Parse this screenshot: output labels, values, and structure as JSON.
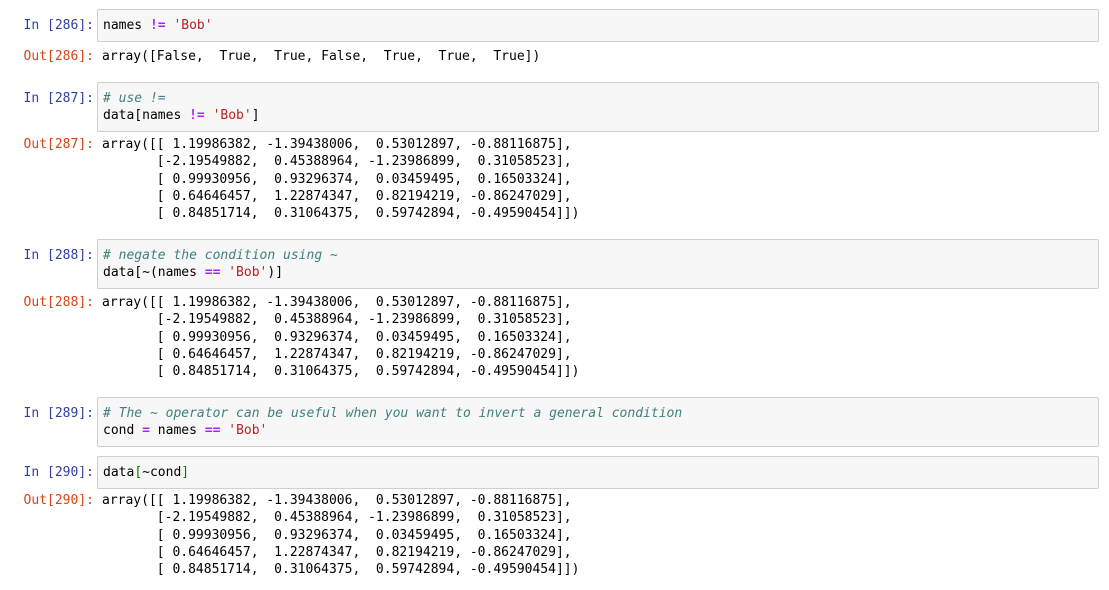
{
  "cells": [
    {
      "in_prompt": "In [286]:",
      "in_lines": [
        [
          {
            "t": "plain",
            "s": "names "
          },
          {
            "t": "op",
            "s": "!="
          },
          {
            "t": "plain",
            "s": " "
          },
          {
            "t": "str",
            "s": "'Bob'"
          }
        ]
      ],
      "out_prompt": "Out[286]:",
      "out_lines": [
        "array([False,  True,  True, False,  True,  True,  True])"
      ]
    },
    {
      "in_prompt": "In [287]:",
      "in_lines": [
        [
          {
            "t": "com",
            "s": "# use !="
          }
        ],
        [
          {
            "t": "plain",
            "s": "data[names "
          },
          {
            "t": "op",
            "s": "!="
          },
          {
            "t": "plain",
            "s": " "
          },
          {
            "t": "str",
            "s": "'Bob'"
          },
          {
            "t": "plain",
            "s": "]"
          }
        ]
      ],
      "out_prompt": "Out[287]:",
      "out_lines": [
        "array([[ 1.19986382, -1.39438006,  0.53012897, -0.88116875],",
        "       [-2.19549882,  0.45388964, -1.23986899,  0.31058523],",
        "       [ 0.99930956,  0.93296374,  0.03459495,  0.16503324],",
        "       [ 0.64646457,  1.22874347,  0.82194219, -0.86247029],",
        "       [ 0.84851714,  0.31064375,  0.59742894, -0.49590454]])"
      ]
    },
    {
      "in_prompt": "In [288]:",
      "in_lines": [
        [
          {
            "t": "com",
            "s": "# negate the condition using ~"
          }
        ],
        [
          {
            "t": "plain",
            "s": "data[~(names "
          },
          {
            "t": "op",
            "s": "=="
          },
          {
            "t": "plain",
            "s": " "
          },
          {
            "t": "str",
            "s": "'Bob'"
          },
          {
            "t": "plain",
            "s": ")]"
          }
        ]
      ],
      "out_prompt": "Out[288]:",
      "out_lines": [
        "array([[ 1.19986382, -1.39438006,  0.53012897, -0.88116875],",
        "       [-2.19549882,  0.45388964, -1.23986899,  0.31058523],",
        "       [ 0.99930956,  0.93296374,  0.03459495,  0.16503324],",
        "       [ 0.64646457,  1.22874347,  0.82194219, -0.86247029],",
        "       [ 0.84851714,  0.31064375,  0.59742894, -0.49590454]])"
      ]
    },
    {
      "in_prompt": "In [289]:",
      "in_lines": [
        [
          {
            "t": "com",
            "s": "# The ~ operator can be useful when you want to invert a general condition"
          }
        ],
        [
          {
            "t": "plain",
            "s": "cond "
          },
          {
            "t": "op",
            "s": "="
          },
          {
            "t": "plain",
            "s": " names "
          },
          {
            "t": "op",
            "s": "=="
          },
          {
            "t": "plain",
            "s": " "
          },
          {
            "t": "str",
            "s": "'Bob'"
          }
        ]
      ],
      "out_prompt": "",
      "out_lines": []
    },
    {
      "in_prompt": "In [290]:",
      "in_lines": [
        [
          {
            "t": "plain",
            "s": "data"
          },
          {
            "t": "br",
            "s": "["
          },
          {
            "t": "plain",
            "s": "~cond"
          },
          {
            "t": "br",
            "s": "]"
          }
        ]
      ],
      "out_prompt": "Out[290]:",
      "out_lines": [
        "array([[ 1.19986382, -1.39438006,  0.53012897, -0.88116875],",
        "       [-2.19549882,  0.45388964, -1.23986899,  0.31058523],",
        "       [ 0.99930956,  0.93296374,  0.03459495,  0.16503324],",
        "       [ 0.64646457,  1.22874347,  0.82194219, -0.86247029],",
        "       [ 0.84851714,  0.31064375,  0.59742894, -0.49590454]])"
      ]
    }
  ]
}
